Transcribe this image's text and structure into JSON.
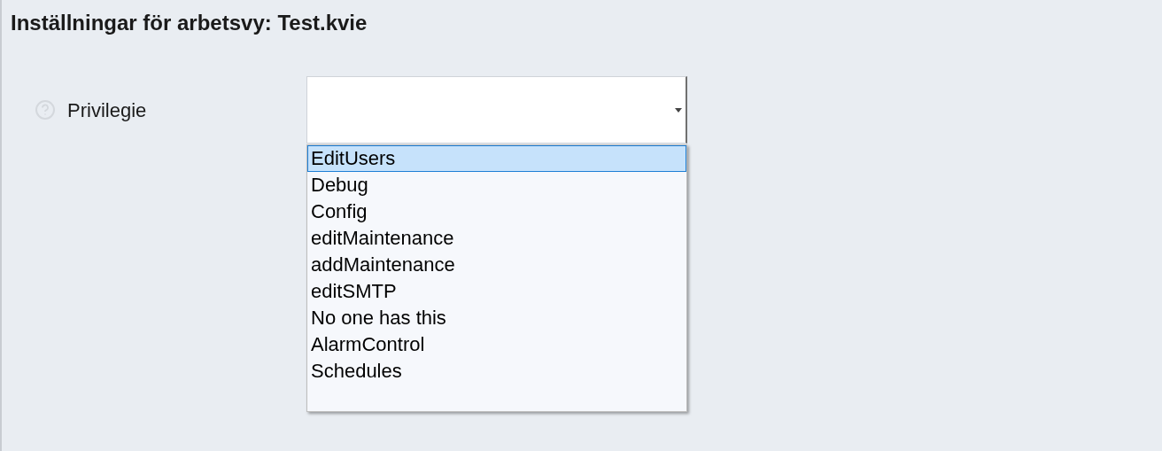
{
  "title": "Inställningar för arbetsvy: Test.kvie",
  "field": {
    "label": "Privilegie",
    "expanded": true,
    "options": [
      {
        "label": "EditUsers",
        "selected": true
      },
      {
        "label": "Debug",
        "selected": false
      },
      {
        "label": "Config",
        "selected": false
      },
      {
        "label": "editMaintenance",
        "selected": false
      },
      {
        "label": "addMaintenance",
        "selected": false
      },
      {
        "label": "editSMTP",
        "selected": false
      },
      {
        "label": "No one has this",
        "selected": false
      },
      {
        "label": "AlarmControl",
        "selected": false
      },
      {
        "label": "Schedules",
        "selected": false
      }
    ]
  }
}
